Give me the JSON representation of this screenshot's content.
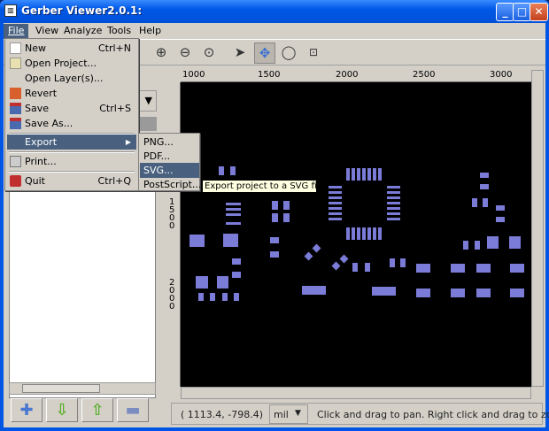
{
  "window": {
    "title": "Gerber Viewer2.0.1:"
  },
  "menubar": [
    {
      "label": "File",
      "active": true
    },
    {
      "label": "View"
    },
    {
      "label": "Analyze"
    },
    {
      "label": "Tools"
    },
    {
      "label": "Help"
    }
  ],
  "file_menu": [
    {
      "label": "New",
      "accel": "Ctrl+N",
      "icon": "new-file-icon"
    },
    {
      "label": "Open Project...",
      "icon": "folder-icon"
    },
    {
      "label": "Open Layer(s)..."
    },
    {
      "label": "Revert",
      "icon": "revert-icon"
    },
    {
      "label": "Save",
      "accel": "Ctrl+S",
      "icon": "save-icon"
    },
    {
      "label": "Save As...",
      "icon": "save-as-icon"
    },
    {
      "label": "Export",
      "submenu": true,
      "highlighted": true
    },
    {
      "label": "Print...",
      "icon": "printer-icon"
    },
    {
      "label": "Quit",
      "accel": "Ctrl+Q",
      "icon": "quit-icon"
    }
  ],
  "export_submenu": [
    {
      "label": "PNG..."
    },
    {
      "label": "PDF..."
    },
    {
      "label": "SVG...",
      "highlighted": true
    },
    {
      "label": "PostScript..."
    }
  ],
  "tooltip": "Export project to a SVG file",
  "toolbar": [
    "zoom-in-icon",
    "zoom-out-icon",
    "zoom-fit-icon",
    "pointer-icon",
    "pan-icon",
    "zoom-tool-icon",
    "measure-icon"
  ],
  "ruler": {
    "h_ticks": [
      "1000",
      "1500",
      "2000",
      "2500",
      "3000"
    ],
    "v_ticks": [
      "1500",
      "2000"
    ]
  },
  "layer_buttons": [
    "add-layer-icon",
    "move-down-icon",
    "move-up-icon",
    "remove-layer-icon"
  ],
  "status": {
    "coords": "( 1113.4,  -798.4)",
    "unit": "mil",
    "hint": "Click and drag to pan. Right click and drag to zoom."
  },
  "colors": {
    "pad": "#7b7bd8",
    "canvas": "#000000",
    "menu_highlight": "#49617f"
  }
}
